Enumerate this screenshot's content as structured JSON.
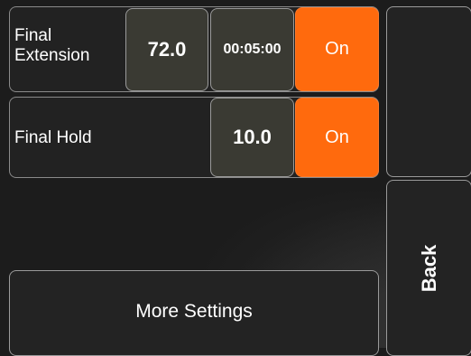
{
  "rows": [
    {
      "label_line1": "Final",
      "label_line2": "Extension",
      "value": "72.0",
      "time": "00:05:00",
      "toggle": "On"
    },
    {
      "label": "Final Hold",
      "value": "10.0",
      "toggle": "On"
    }
  ],
  "buttons": {
    "more_settings": "More Settings",
    "back": "Back"
  },
  "colors": {
    "accent_on": "#ff6a0d",
    "value_cell": "#3a3a33",
    "panel_border": "#8a8a8a",
    "background": "#1c1c1c"
  }
}
